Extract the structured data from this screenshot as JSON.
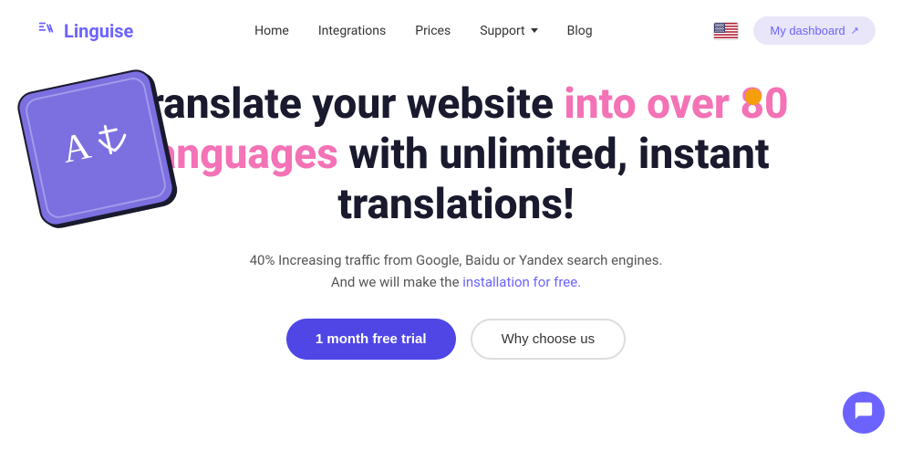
{
  "nav": {
    "logo_text": "Linguise",
    "links": [
      {
        "label": "Home",
        "name": "home"
      },
      {
        "label": "Integrations",
        "name": "integrations"
      },
      {
        "label": "Prices",
        "name": "prices"
      },
      {
        "label": "Support",
        "name": "support",
        "has_dropdown": true
      },
      {
        "label": "Blog",
        "name": "blog"
      }
    ],
    "dashboard_btn": "My dashboard",
    "dashboard_icon": "↗"
  },
  "hero": {
    "title_part1": "Translate your website ",
    "title_highlight": "into over 80 languages",
    "title_part2": " with unlimited, instant translations!",
    "subtitle_line1": "40% Increasing traffic from Google, Baidu or Yandex search engines.",
    "subtitle_line2": "And we will make the ",
    "subtitle_link": "installation for free.",
    "btn_primary": "1 month free trial",
    "btn_secondary": "Why choose us"
  },
  "decoration": {
    "orange_dot_color": "#f59e0b",
    "chat_icon": "💬"
  },
  "colors": {
    "brand": "#6c63ff",
    "highlight": "#f472b6",
    "primary_btn": "#4f46e5",
    "dashboard_bg": "#e8e6f8"
  }
}
